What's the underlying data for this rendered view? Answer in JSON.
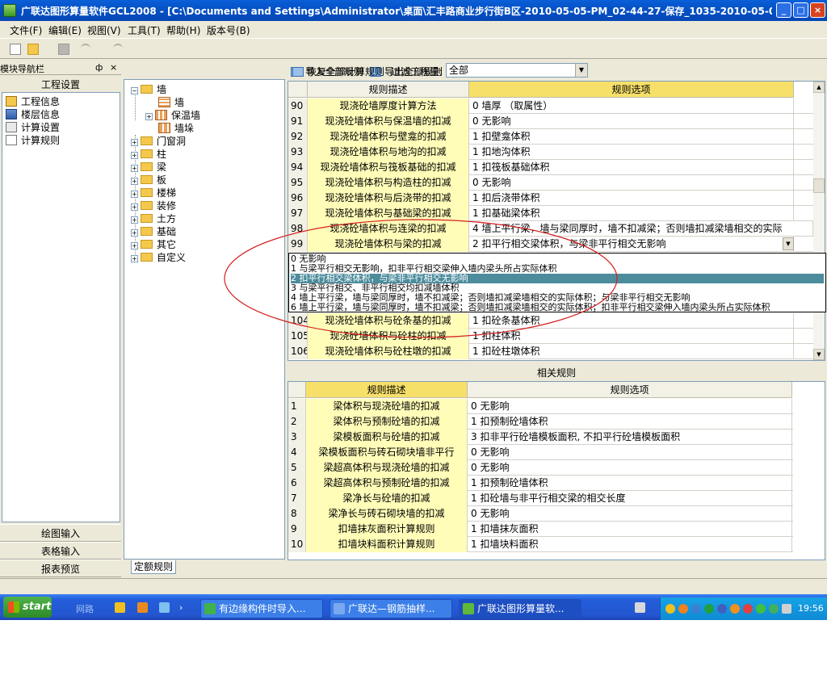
{
  "window": {
    "title": "广联达图形算量软件GCL2008 - [C:\\Documents and Settings\\Administrator\\桌面\\汇丰路商业步行街B区-2010-05-05-PM_02-44-27-保存_1035-2010-05-06-AM 09-32-27-打开_...",
    "min_label": "_",
    "max_label": "□",
    "close_label": "×"
  },
  "menu": [
    "文件(F)",
    "编辑(E)",
    "视图(V)",
    "工具(T)",
    "帮助(H)",
    "版本号(B)"
  ],
  "nav": {
    "header": "模块导航栏",
    "pin": "ф",
    "close": "×",
    "section_title": "工程设置",
    "items": [
      "工程信息",
      "楼层信息",
      "计算设置",
      "计算规则"
    ],
    "bottom": [
      "绘图输入",
      "表格输入",
      "报表预览"
    ]
  },
  "tree": {
    "root": "墙",
    "children": [
      "墙",
      "保温墙",
      "墙垛"
    ],
    "nodes": [
      "门窗洞",
      "柱",
      "梁",
      "板",
      "楼梯",
      "装修",
      "土方",
      "基础",
      "其它",
      "自定义"
    ],
    "tab": "定额规则"
  },
  "filter": {
    "import_all": "导入全部规则",
    "export_all": "导出全部规则",
    "restore_all": "恢复全部计算规则",
    "filter_label": "过滤工程量:",
    "filter_value": "全部"
  },
  "rules": {
    "headers": [
      "规则描述",
      "规则选项"
    ],
    "rows": [
      {
        "num": "90",
        "desc": "现浇砼墙厚度计算方法",
        "opt": "0  墙厚 （取属性）"
      },
      {
        "num": "91",
        "desc": "现浇砼墙体积与保温墙的扣减",
        "opt": "0  无影响"
      },
      {
        "num": "92",
        "desc": "现浇砼墙体积与壁龛的扣减",
        "opt": "1  扣壁龛体积"
      },
      {
        "num": "93",
        "desc": "现浇砼墙体积与地沟的扣减",
        "opt": "1  扣地沟体积"
      },
      {
        "num": "94",
        "desc": "现浇砼墙体积与筏板基础的扣减",
        "opt": "1  扣筏板基础体积"
      },
      {
        "num": "95",
        "desc": "现浇砼墙体积与构造柱的扣减",
        "opt": "0  无影响"
      },
      {
        "num": "96",
        "desc": "现浇砼墙体积与后浇带的扣减",
        "opt": "1   扣后浇带体积"
      },
      {
        "num": "97",
        "desc": "现浇砼墙体积与基础梁的扣减",
        "opt": "1  扣基础梁体积"
      },
      {
        "num": "98",
        "desc": "现浇砼墙体积与连梁的扣减",
        "opt": "4  墙上平行梁，墙与梁同厚时，墙不扣减梁；否则墙扣减梁墙相交的实际"
      },
      {
        "num": "99",
        "desc": "现浇砼墙体积与梁的扣减",
        "opt": "2  扣平行相交梁体积，与梁非平行相交无影响"
      }
    ],
    "rows_after": [
      {
        "num": "104",
        "desc": "现浇砼墙体积与砼条基的扣减",
        "opt": "1  扣砼条基体积"
      },
      {
        "num": "105",
        "desc": "现浇砼墙体积与砼柱的扣减",
        "opt": "1  扣柱体积"
      },
      {
        "num": "106",
        "desc": "现浇砼墙体积与砼柱墩的扣减",
        "opt": "1  扣砼柱墩体积"
      }
    ],
    "dropdown_options": [
      "0  无影响",
      "1  与梁平行相交无影响，扣非平行相交梁伸入墙内梁头所占实际体积",
      "2  扣平行相交梁体积，与梁非平行相交无影响",
      "3  与梁平行相交、非平行相交均扣减墙体积",
      "4  墙上平行梁，墙与梁同厚时，墙不扣减梁；否则墙扣减梁墙相交的实际体积；与梁非平行相交无影响",
      "6  墙上平行梁，墙与梁同厚时，墙不扣减梁；否则墙扣减梁墙相交的实际体积；扣非平行相交梁伸入墙内梁头所占实际体积"
    ],
    "dropdown_selected_index": 2
  },
  "related": {
    "title": "相关规则",
    "headers": [
      "规则描述",
      "规则选项"
    ],
    "rows": [
      {
        "num": "1",
        "desc": "梁体积与现浇砼墙的扣减",
        "opt": "0  无影响"
      },
      {
        "num": "2",
        "desc": "梁体积与预制砼墙的扣减",
        "opt": "1  扣预制砼墙体积"
      },
      {
        "num": "3",
        "desc": "梁模板面积与砼墙的扣减",
        "opt": "3 扣非平行砼墙模板面积, 不扣平行砼墙模板面积"
      },
      {
        "num": "4",
        "desc": "梁模板面积与砖石砌块墙非平行",
        "opt": "0  无影响"
      },
      {
        "num": "5",
        "desc": "梁超高体积与现浇砼墙的扣减",
        "opt": "0  无影响"
      },
      {
        "num": "6",
        "desc": "梁超高体积与预制砼墙的扣减",
        "opt": "1 扣预制砼墙体积"
      },
      {
        "num": "7",
        "desc": "梁净长与砼墙的扣减",
        "opt": "1 扣砼墙与非平行相交梁的相交长度"
      },
      {
        "num": "8",
        "desc": "梁净长与砖石砌块墙的扣减",
        "opt": "0  无影响"
      },
      {
        "num": "9",
        "desc": "扣墙抹灰面积计算规则",
        "opt": "1 扣墙抹灰面积"
      },
      {
        "num": "10",
        "desc": "扣墙块料面积计算规则",
        "opt": "1 扣墙块料面积"
      }
    ]
  },
  "taskbar": {
    "start": "start",
    "lang": "网路",
    "tasks": [
      "有边缘构件时导入...",
      "广联达—钢筋抽样...",
      "广联达图形算量软..."
    ],
    "clock": "19:56"
  },
  "colors": {
    "titlebar": "#0552c7",
    "desc_column": "#fffdb8",
    "header_selected": "#f7e06a",
    "dropdown_selected": "#4c8c9c",
    "annotation": "#d42020"
  }
}
